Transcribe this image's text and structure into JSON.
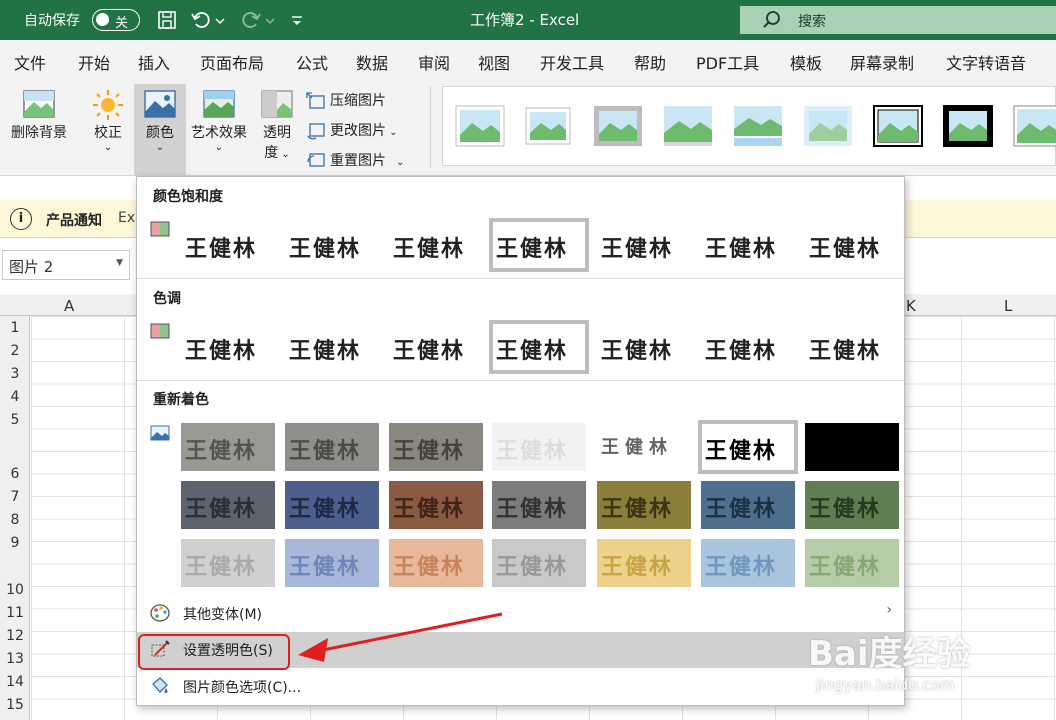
{
  "titlebar": {
    "autosave_label": "自动保存",
    "toggle_label": "关",
    "title": "工作簿2 - Excel",
    "search_label": "搜索"
  },
  "menu_tabs": [
    "文件",
    "开始",
    "插入",
    "页面布局",
    "公式",
    "数据",
    "审阅",
    "视图",
    "开发工具",
    "帮助",
    "PDF工具",
    "模板",
    "屏幕录制",
    "文字转语音"
  ],
  "ribbon": {
    "remove_background": "删除背景",
    "corrections": "校正",
    "color": "颜色",
    "artistic_effects": "艺术效果",
    "transparency_line1": "透明",
    "transparency_line2": "度",
    "compress": "压缩图片",
    "change": "更改图片",
    "reset": "重置图片"
  },
  "notification": {
    "title": "产品通知",
    "text": "Ex"
  },
  "namebox": {
    "value": "图片 2"
  },
  "columns": [
    "A",
    "K",
    "L"
  ],
  "rows": [
    "1",
    "2",
    "3",
    "4",
    "5",
    "6",
    "7",
    "8",
    "9",
    "10",
    "11",
    "12",
    "13",
    "14",
    "15"
  ],
  "dropdown": {
    "saturation_header": "颜色饱和度",
    "tone_header": "色调",
    "recolor_header": "重新着色",
    "thumb_text": "王健林",
    "more_variations": "其他变体(M)",
    "set_transparent": "设置透明色(S)",
    "color_options": "图片颜色选项(C)..."
  },
  "recolor_colors": {
    "row1": [
      "#9a9a94",
      "#8e8e8a",
      "#8a8680",
      "#f2f2f2",
      "#ffffff",
      "#ffffff",
      "#000000"
    ],
    "row2": [
      "#5d6470",
      "#4d5f8c",
      "#8a5a42",
      "#7c7c7c",
      "#8a7f3a",
      "#4e6f8e",
      "#5f7f52"
    ],
    "row3": [
      "#d0d0d0",
      "#a9b8d8",
      "#e7b899",
      "#c9c9c9",
      "#ecd28a",
      "#a9c4dd",
      "#b6cca8"
    ]
  },
  "watermark": {
    "brand": "Bai度经验",
    "url": "jingyan.baidu.com"
  }
}
